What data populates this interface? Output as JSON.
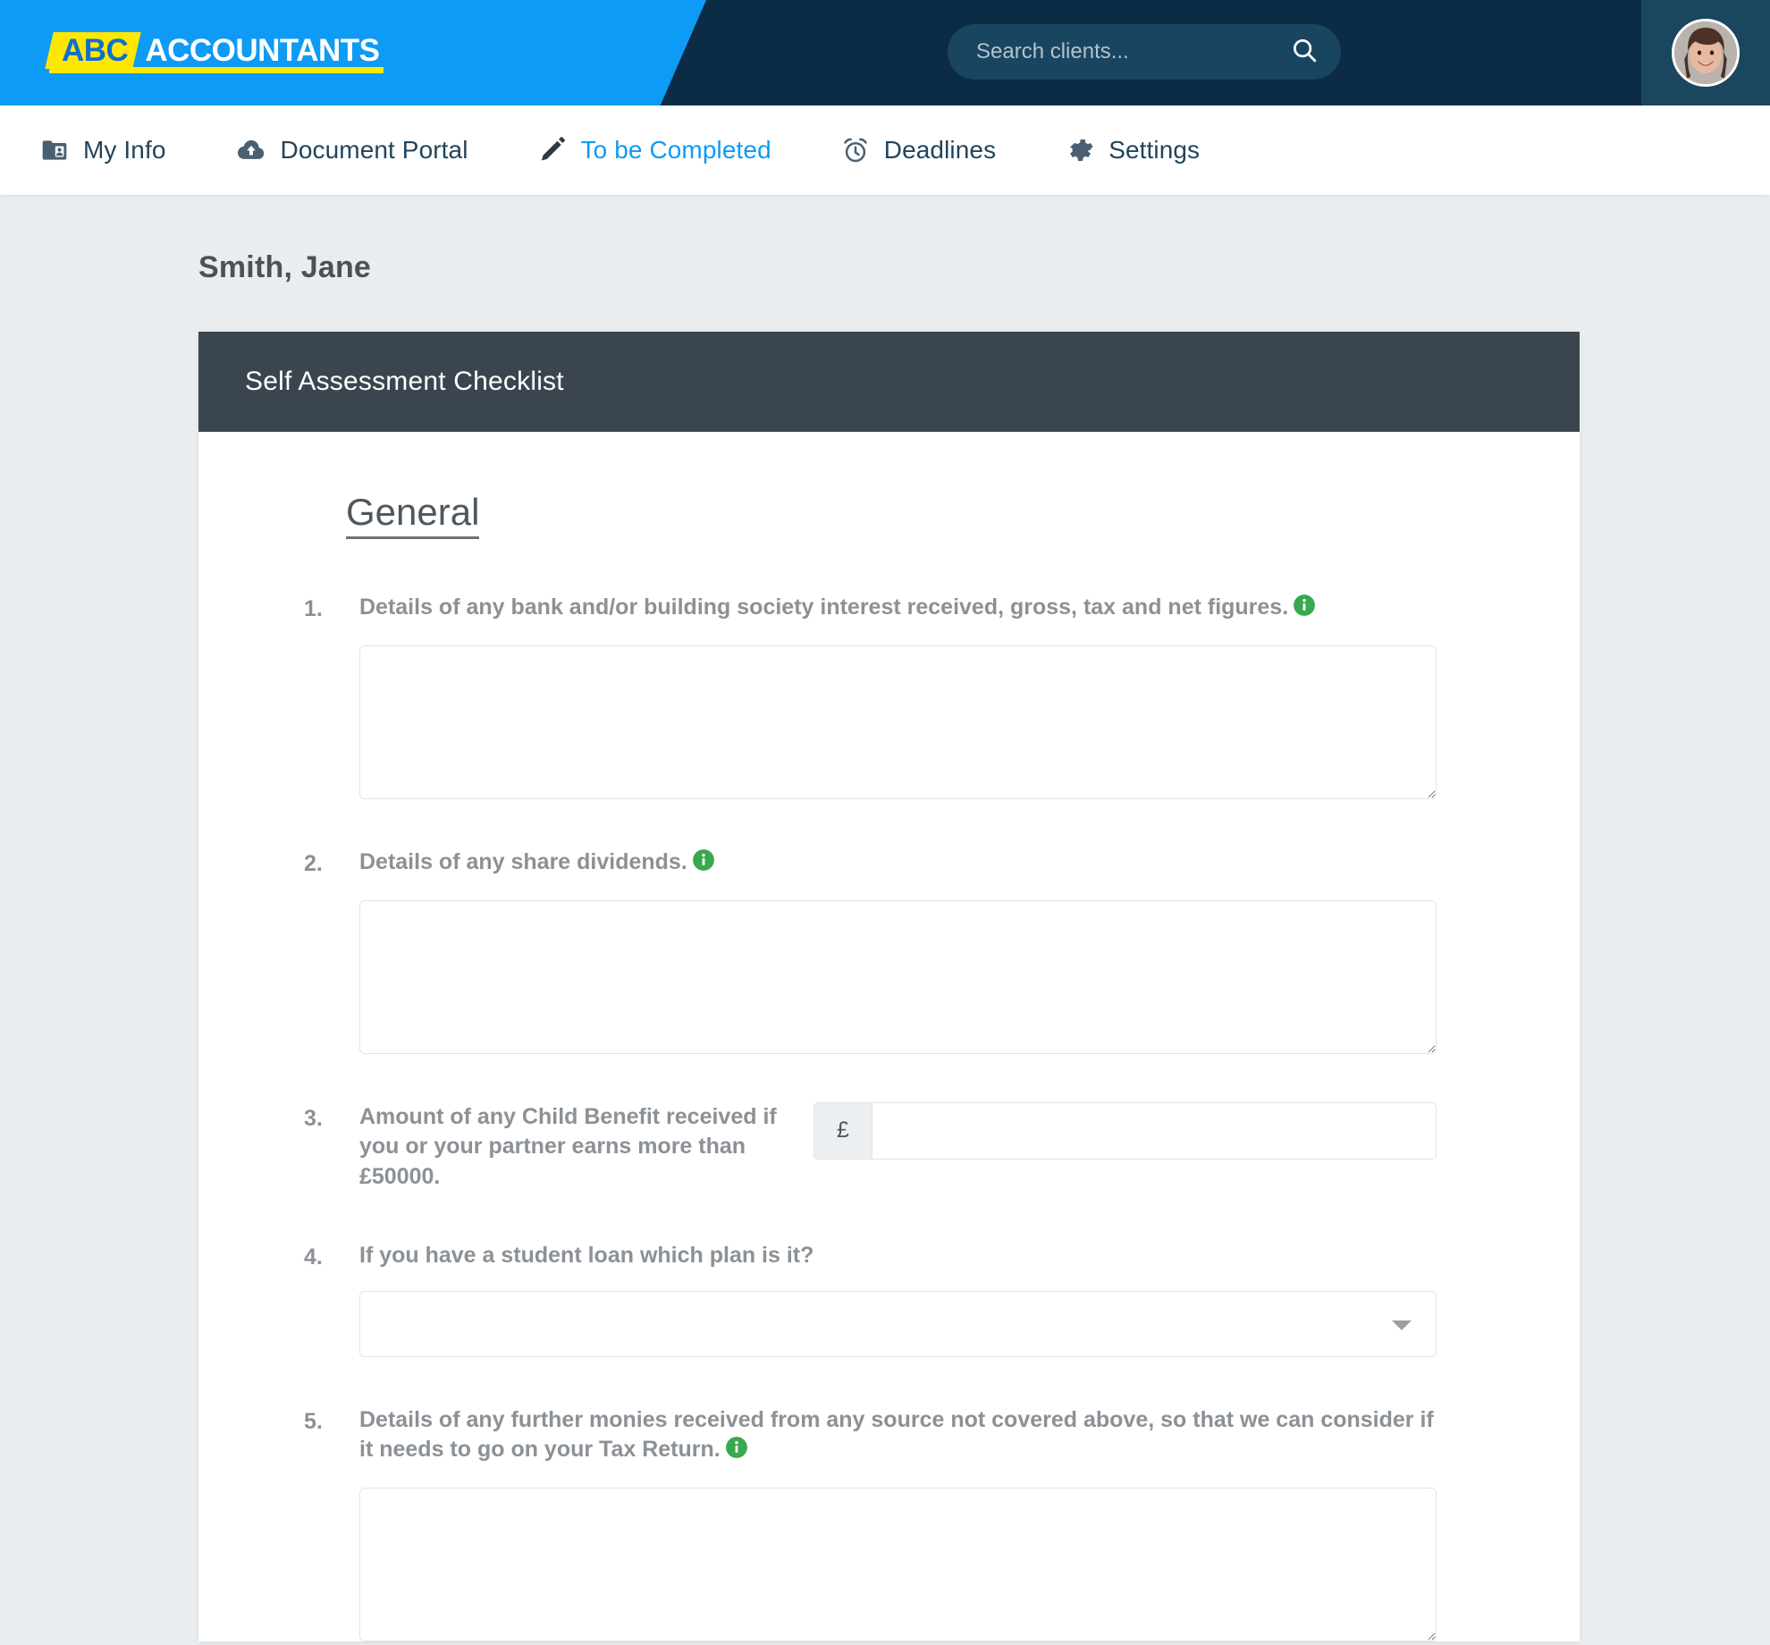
{
  "brand": {
    "logo_part1": "ABC",
    "logo_part2": "ACCOUNTANTS",
    "accent_blue": "#0d9bf5",
    "accent_yellow": "#ffe800",
    "dark_navy": "#0b2c44"
  },
  "header": {
    "search": {
      "placeholder": "Search clients...",
      "value": "",
      "icon": "search-icon"
    },
    "avatar_alt": "user-avatar"
  },
  "nav": {
    "items": [
      {
        "label": "My Info",
        "icon": "contact-card-icon",
        "active": false
      },
      {
        "label": "Document Portal",
        "icon": "cloud-upload-icon",
        "active": false
      },
      {
        "label": "To be Completed",
        "icon": "pencil-icon",
        "active": true
      },
      {
        "label": "Deadlines",
        "icon": "alarm-clock-icon",
        "active": false
      },
      {
        "label": "Settings",
        "icon": "gear-icon",
        "active": false
      }
    ]
  },
  "page": {
    "client_name": "Smith, Jane"
  },
  "card": {
    "title": "Self Assessment Checklist",
    "section_title": "General",
    "questions": [
      {
        "number": "1.",
        "text": "Details of any bank and/or building society interest received, gross, tax and net figures.",
        "info": true,
        "control": "textarea",
        "value": ""
      },
      {
        "number": "2.",
        "text": "Details of any share dividends.",
        "info": true,
        "control": "textarea",
        "value": ""
      },
      {
        "number": "3.",
        "text": "Amount of any Child Benefit received if you or your partner earns more than £50000.",
        "info": false,
        "control": "currency",
        "currency_symbol": "£",
        "value": ""
      },
      {
        "number": "4.",
        "text": "If you have a student loan which plan is it?",
        "info": false,
        "control": "select",
        "selected": "",
        "options": [
          ""
        ]
      },
      {
        "number": "5.",
        "text": "Details of any further monies received from any source not covered above, so that we can consider if it needs to go on your Tax Return.",
        "info": true,
        "control": "textarea",
        "value": ""
      }
    ]
  },
  "colors": {
    "info_icon_green": "#39a84f",
    "card_header_slate": "#3a454f",
    "page_background": "#e9edf0",
    "question_text": "#8b9196"
  }
}
